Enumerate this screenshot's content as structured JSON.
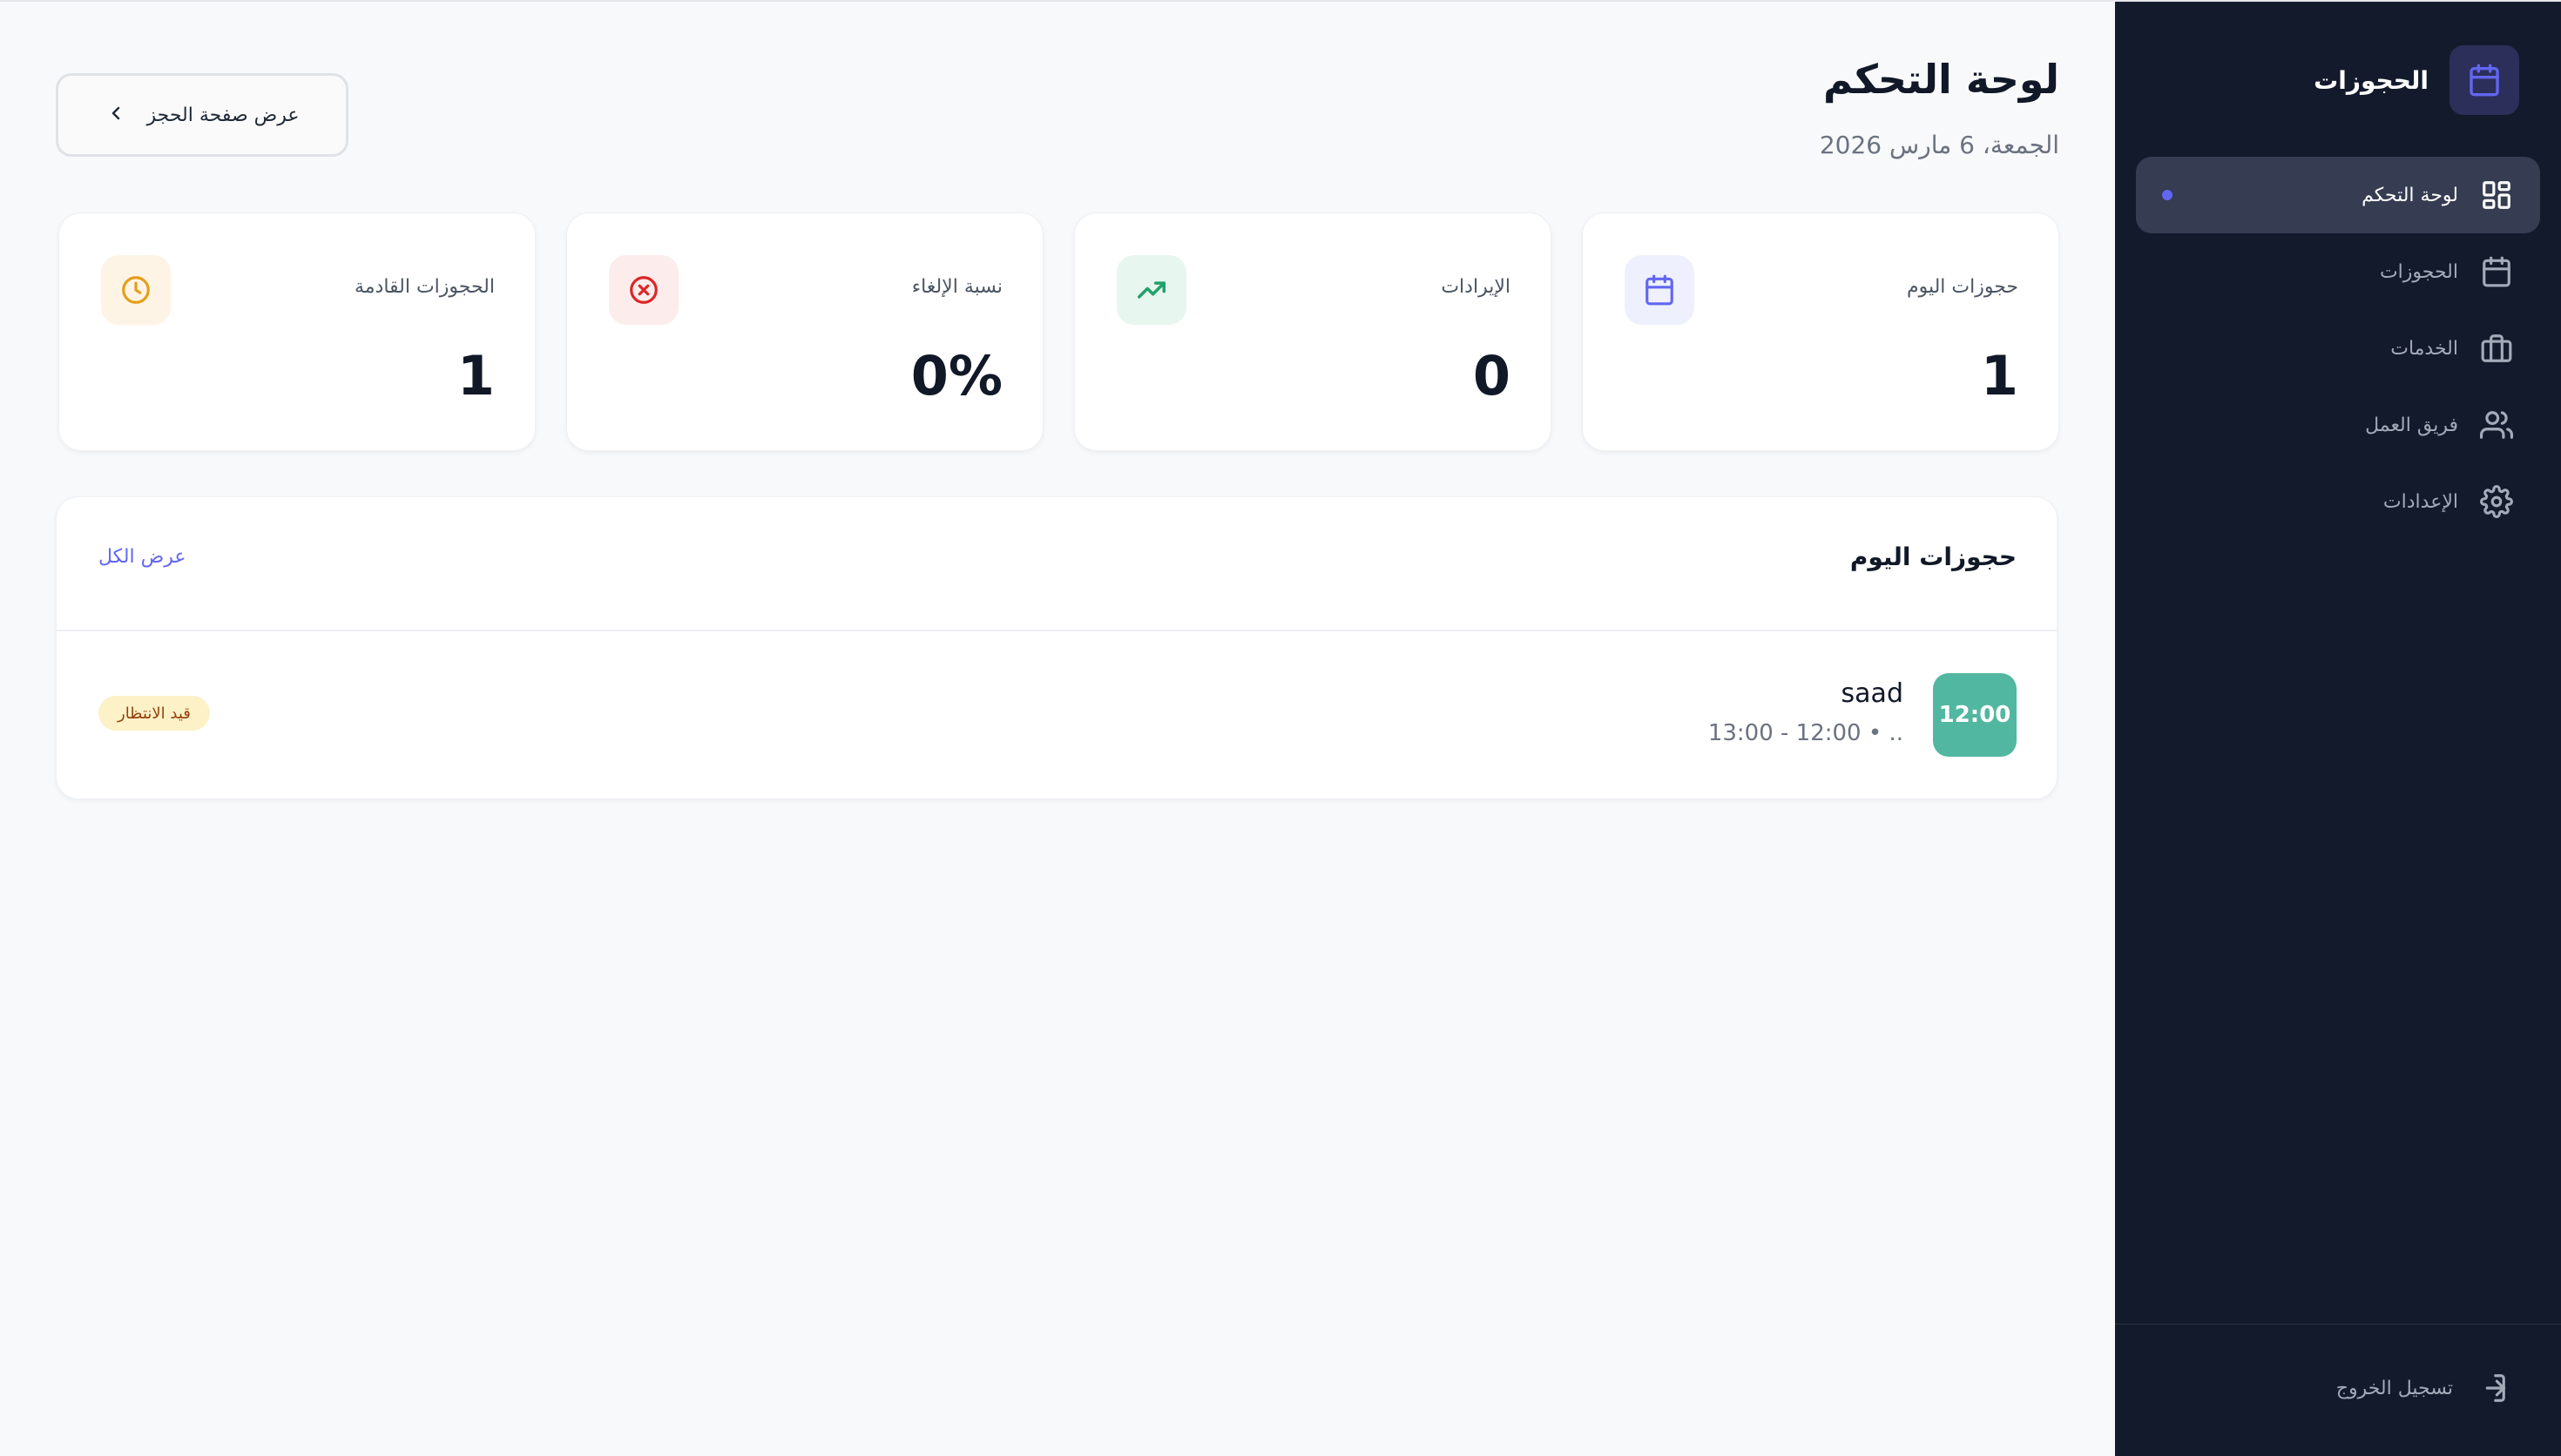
{
  "sidebar": {
    "brand": {
      "title": "الحجوزات",
      "icon": "calendar-icon"
    },
    "items": [
      {
        "label": "لوحة التحكم",
        "icon": "dashboard-grid-icon",
        "active": true
      },
      {
        "label": "الحجوزات",
        "icon": "calendar-icon",
        "active": false
      },
      {
        "label": "الخدمات",
        "icon": "briefcase-icon",
        "active": false
      },
      {
        "label": "فريق العمل",
        "icon": "users-icon",
        "active": false
      },
      {
        "label": "الإعدادات",
        "icon": "gear-icon",
        "active": false
      }
    ],
    "logout_label": "تسجيل الخروج"
  },
  "header": {
    "title": "لوحة التحكم",
    "date": "الجمعة، 6 مارس 2026",
    "view_booking_label": "عرض صفحة الحجز"
  },
  "stats": [
    {
      "label": "حجوزات اليوم",
      "value": "1",
      "icon": "calendar-icon",
      "color": "#6366f1",
      "bg": "#eef0fd"
    },
    {
      "label": "الإيرادات",
      "value": "0",
      "icon": "trending-up-icon",
      "color": "#22a06b",
      "bg": "#e7f6ee"
    },
    {
      "label": "نسبة الإلغاء",
      "value": "0%",
      "icon": "x-circle-icon",
      "color": "#dc2626",
      "bg": "#fdecec"
    },
    {
      "label": "الحجوزات القادمة",
      "value": "1",
      "icon": "clock-icon",
      "color": "#e59e1a",
      "bg": "#fef4e6"
    }
  ],
  "today_bookings": {
    "title": "حجوزات اليوم",
    "view_all_label": "عرض الكل",
    "items": [
      {
        "time": "12:00",
        "name": "saad",
        "details": "13:00 - 12:00 • ..",
        "status": "قيد الانتظار"
      }
    ]
  },
  "colors": {
    "sidebar_bg": "#131a2c",
    "accent": "#6366f1",
    "time_badge": "#52b7a0"
  }
}
